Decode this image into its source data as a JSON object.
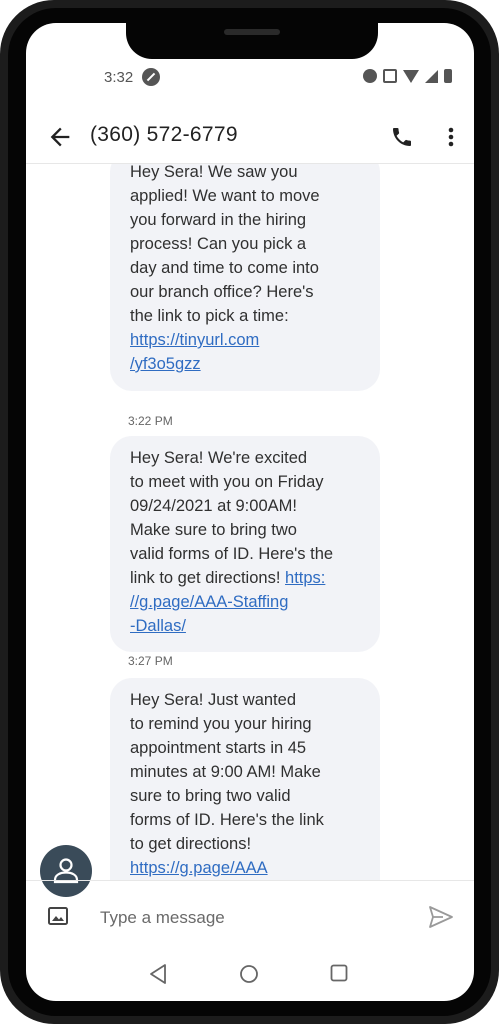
{
  "status_bar": {
    "time": "3:32",
    "icons": [
      "do-not-disturb-icon",
      "alarm-icon",
      "vibrate-icon",
      "wifi-icon",
      "signal-icon",
      "battery-icon"
    ]
  },
  "header": {
    "title": "(360) 572-6779",
    "icons": [
      "back-arrow-icon",
      "phone-call-icon",
      "more-vert-icon"
    ]
  },
  "messages": [
    {
      "text": "Hey Sera! We saw you\napplied! We want to move\nyou forward in the hiring\nprocess! Can you pick a\nday and time to come into\nour branch office? Here's\nthe link to pick a time:",
      "link": "https://tinyurl.com\n/yf3o5gzz",
      "timestamp": "3:22 PM"
    },
    {
      "text": "Hey Sera! We're excited\nto meet with you on Friday\n09/24/2021 at 9:00AM!\nMake sure to bring two\nvalid forms of ID. Here's the\nlink to get directions!",
      "link": "https:\n//g.page/AAA-Staffing\n-Dallas/",
      "timestamp": "3:27 PM"
    },
    {
      "text": "Hey Sera! Just wanted\nto remind you your hiring\nappointment starts in 45\nminutes at 9:00 AM! Make\nsure to bring two valid\nforms of ID. Here's the link\nto get directions!",
      "link": "https://g.page/AAA\n-Staffing-Dallas/",
      "timestamp": ""
    }
  ],
  "composer": {
    "placeholder": "Type a message",
    "icons": [
      "gallery-icon",
      "send-icon"
    ]
  },
  "nav_bar": {
    "icons": [
      "nav-back-icon",
      "nav-home-icon",
      "nav-recents-icon"
    ]
  },
  "colors": {
    "bubble_bg": "#f2f3f7",
    "link": "#2f6cc2",
    "avatar_bg": "#3a4b59",
    "phone_frame": "#1c1c1c"
  }
}
